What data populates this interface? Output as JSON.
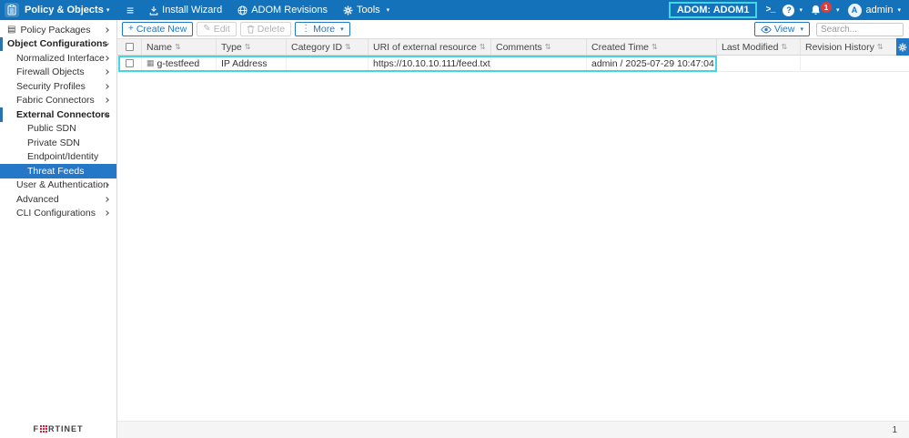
{
  "colors": {
    "topbar_blue": "#1372ba",
    "accent_blue": "#2178c4",
    "selected_blue": "#2577c8",
    "highlight_cyan": "#41d6e3",
    "badge_red": "#e03c3c",
    "brand_red": "#e31837"
  },
  "icons": {
    "hamburger": "≡",
    "console_prompt": ">_",
    "help": "?",
    "more_dots": "⋮",
    "sort": "⇅",
    "plus": "+",
    "edit_pencil": "✎",
    "grid": "▦",
    "package": "▤",
    "caret_down": "▾"
  },
  "topbar": {
    "app_title": "Policy & Objects",
    "install_wizard_label": "Install Wizard",
    "adom_revisions_label": "ADOM Revisions",
    "tools_label": "Tools",
    "adom_label": "ADOM: ADOM1",
    "notification_count": "1",
    "user_name": "admin",
    "avatar_initial": "A"
  },
  "sidebar": {
    "items": [
      {
        "label": "Policy Packages"
      },
      {
        "label": "Object Configurations"
      },
      {
        "label": "Normalized Interface"
      },
      {
        "label": "Firewall Objects"
      },
      {
        "label": "Security Profiles"
      },
      {
        "label": "Fabric Connectors"
      },
      {
        "label": "External Connectors"
      },
      {
        "label": "Public SDN"
      },
      {
        "label": "Private SDN"
      },
      {
        "label": "Endpoint/Identity"
      },
      {
        "label": "Threat Feeds"
      },
      {
        "label": "User & Authentication"
      },
      {
        "label": "Advanced"
      },
      {
        "label": "CLI Configurations"
      }
    ]
  },
  "toolbar": {
    "create_label": "Create New",
    "edit_label": "Edit",
    "delete_label": "Delete",
    "more_label": "More",
    "view_label": "View",
    "search_placeholder": "Search..."
  },
  "table": {
    "columns": [
      "Name",
      "Type",
      "Category ID",
      "URI of external resource",
      "Comments",
      "Created Time",
      "Last Modified",
      "Revision History"
    ],
    "rows": [
      {
        "name": "g-testfeed",
        "type": "IP Address",
        "category_id": "",
        "uri": "https://10.10.10.111/feed.txt",
        "comments": "",
        "created_time": "admin / 2025-07-29 10:47:04",
        "last_modified": "",
        "revision_history": ""
      }
    ]
  },
  "footer": {
    "brand_prefix": "F",
    "brand_suffix": "RTINET",
    "page_number": "1"
  }
}
